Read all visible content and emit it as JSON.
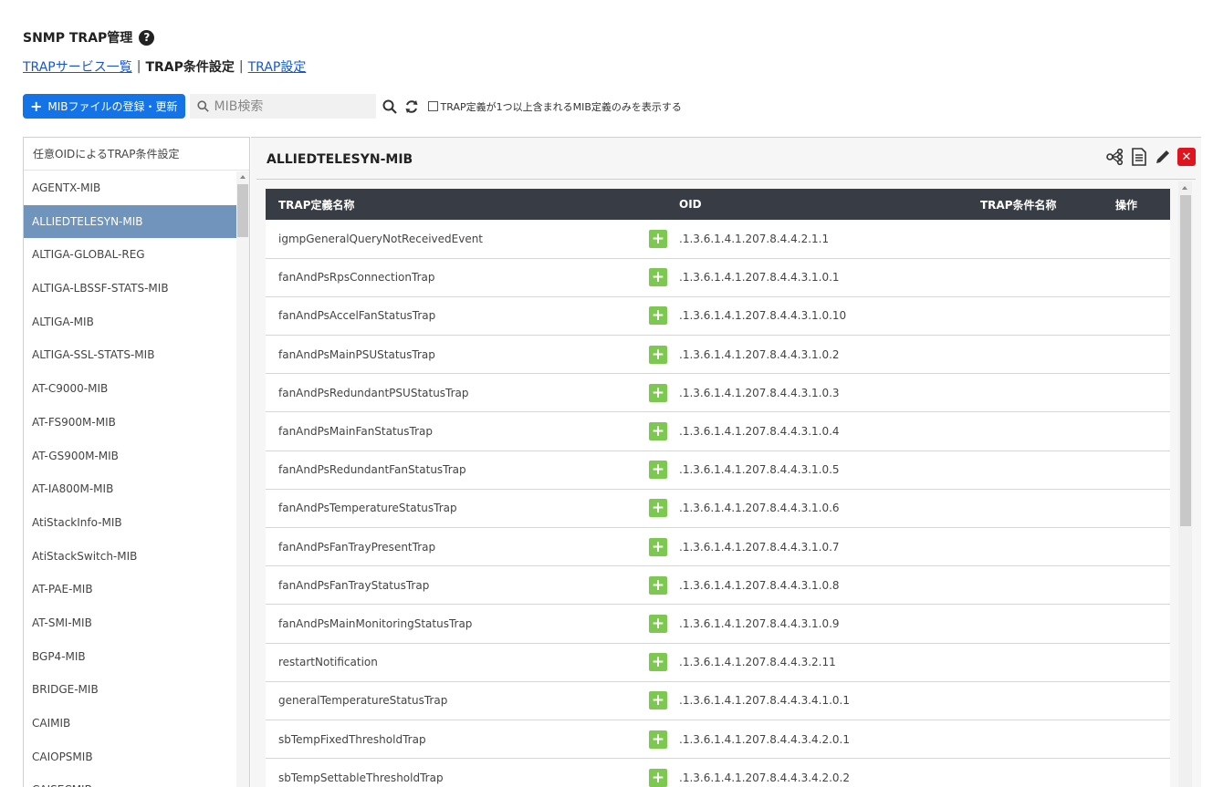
{
  "header": {
    "title": "SNMP TRAP管理",
    "help_icon": "?"
  },
  "nav": {
    "link1": "TRAPサービス一覧",
    "current": "TRAP条件設定",
    "link2": "TRAP設定",
    "separator": "|"
  },
  "toolbar": {
    "register_label": "MIBファイルの登録・更新",
    "register_icon": "+",
    "search_placeholder": "MIB検索",
    "filter_label": "TRAP定義が1つ以上含まれるMIB定義のみを表示する"
  },
  "sidebar": {
    "top_item": "任意OIDによるTRAP条件設定",
    "items": [
      {
        "label": "AGENTX-MIB",
        "selected": false
      },
      {
        "label": "ALLIEDTELESYN-MIB",
        "selected": true
      },
      {
        "label": "ALTIGA-GLOBAL-REG",
        "selected": false
      },
      {
        "label": "ALTIGA-LBSSF-STATS-MIB",
        "selected": false
      },
      {
        "label": "ALTIGA-MIB",
        "selected": false
      },
      {
        "label": "ALTIGA-SSL-STATS-MIB",
        "selected": false
      },
      {
        "label": "AT-C9000-MIB",
        "selected": false
      },
      {
        "label": "AT-FS900M-MIB",
        "selected": false
      },
      {
        "label": "AT-GS900M-MIB",
        "selected": false
      },
      {
        "label": "AT-IA800M-MIB",
        "selected": false
      },
      {
        "label": "AtiStackInfo-MIB",
        "selected": false
      },
      {
        "label": "AtiStackSwitch-MIB",
        "selected": false
      },
      {
        "label": "AT-PAE-MIB",
        "selected": false
      },
      {
        "label": "AT-SMI-MIB",
        "selected": false
      },
      {
        "label": "BGP4-MIB",
        "selected": false
      },
      {
        "label": "BRIDGE-MIB",
        "selected": false
      },
      {
        "label": "CAIMIB",
        "selected": false
      },
      {
        "label": "CAIOPSMIB",
        "selected": false
      },
      {
        "label": "CAISECMIB",
        "selected": false
      }
    ]
  },
  "main": {
    "mib_title": "ALLIEDTELESYN-MIB",
    "delete_icon": "✕",
    "columns": {
      "name": "TRAP定義名称",
      "oid": "OID",
      "condition": "TRAP条件名称",
      "operation": "操作"
    },
    "add_icon": "+",
    "rows": [
      {
        "name": "igmpGeneralQueryNotReceivedEvent",
        "oid": ".1.3.6.1.4.1.207.8.4.4.2.1.1"
      },
      {
        "name": "fanAndPsRpsConnectionTrap",
        "oid": ".1.3.6.1.4.1.207.8.4.4.3.1.0.1"
      },
      {
        "name": "fanAndPsAccelFanStatusTrap",
        "oid": ".1.3.6.1.4.1.207.8.4.4.3.1.0.10"
      },
      {
        "name": "fanAndPsMainPSUStatusTrap",
        "oid": ".1.3.6.1.4.1.207.8.4.4.3.1.0.2"
      },
      {
        "name": "fanAndPsRedundantPSUStatusTrap",
        "oid": ".1.3.6.1.4.1.207.8.4.4.3.1.0.3"
      },
      {
        "name": "fanAndPsMainFanStatusTrap",
        "oid": ".1.3.6.1.4.1.207.8.4.4.3.1.0.4"
      },
      {
        "name": "fanAndPsRedundantFanStatusTrap",
        "oid": ".1.3.6.1.4.1.207.8.4.4.3.1.0.5"
      },
      {
        "name": "fanAndPsTemperatureStatusTrap",
        "oid": ".1.3.6.1.4.1.207.8.4.4.3.1.0.6"
      },
      {
        "name": "fanAndPsFanTrayPresentTrap",
        "oid": ".1.3.6.1.4.1.207.8.4.4.3.1.0.7"
      },
      {
        "name": "fanAndPsFanTrayStatusTrap",
        "oid": ".1.3.6.1.4.1.207.8.4.4.3.1.0.8"
      },
      {
        "name": "fanAndPsMainMonitoringStatusTrap",
        "oid": ".1.3.6.1.4.1.207.8.4.4.3.1.0.9"
      },
      {
        "name": "restartNotification",
        "oid": ".1.3.6.1.4.1.207.8.4.4.3.2.11"
      },
      {
        "name": "generalTemperatureStatusTrap",
        "oid": ".1.3.6.1.4.1.207.8.4.4.3.4.1.0.1"
      },
      {
        "name": "sbTempFixedThresholdTrap",
        "oid": ".1.3.6.1.4.1.207.8.4.4.3.4.2.0.1"
      },
      {
        "name": "sbTempSettableThresholdTrap",
        "oid": ".1.3.6.1.4.1.207.8.4.4.3.4.2.0.2"
      }
    ]
  }
}
